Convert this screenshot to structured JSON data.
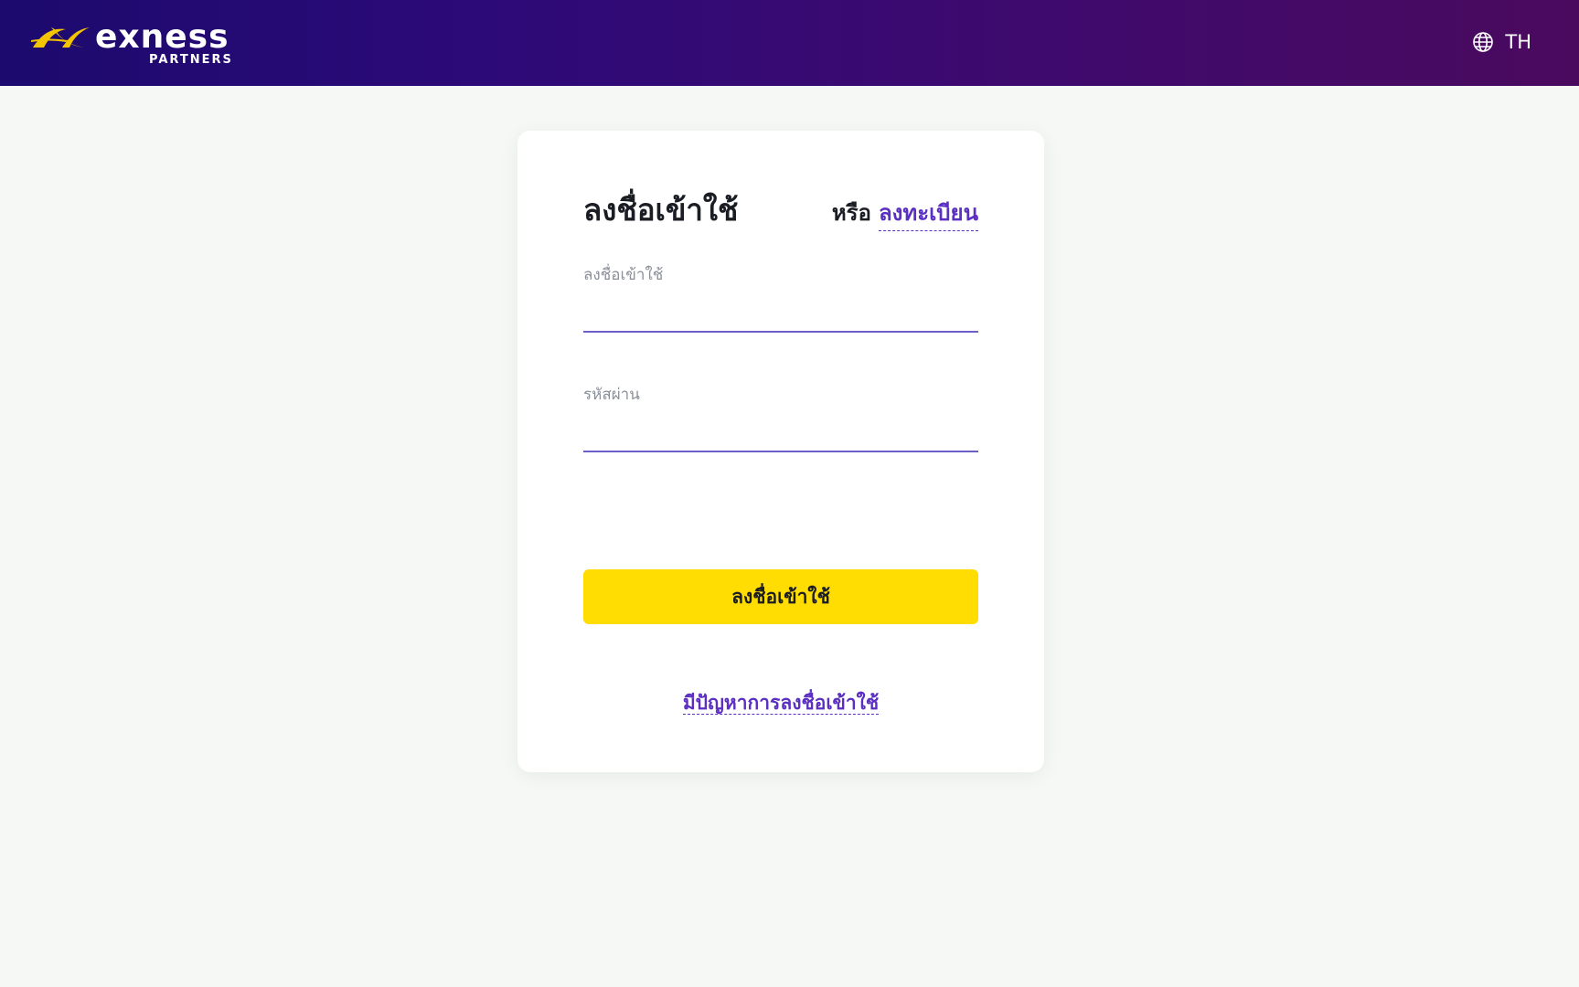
{
  "header": {
    "logo": {
      "brand": "exness",
      "sub": "PARTNERS",
      "mark_color": "#f5c400"
    },
    "language": {
      "icon": "globe-icon",
      "label": "TH"
    }
  },
  "login": {
    "title": "ลงชื่อเข้าใช้",
    "or_text": "หรือ",
    "register_link": "ลงทะเบียน",
    "username": {
      "label": "ลงชื่อเข้าใช้",
      "value": ""
    },
    "password": {
      "label": "รหัสผ่าน",
      "value": ""
    },
    "submit_label": "ลงชื่อเข้าใช้",
    "trouble_link": "มีปัญหาการลงชื่อเข้าใช้"
  },
  "colors": {
    "header_gradient_start": "#1c0a6e",
    "header_gradient_end": "#4a0a5e",
    "accent": "#5b2fc2",
    "button": "#ffdc02",
    "page_bg": "#f5f8f5"
  }
}
